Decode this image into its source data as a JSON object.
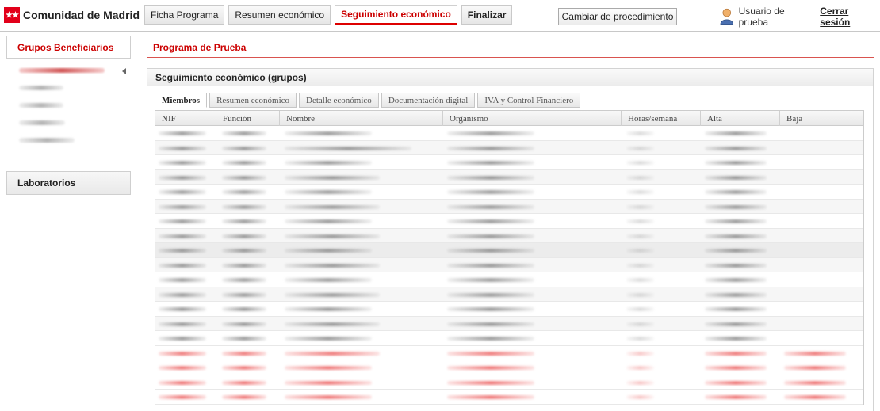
{
  "app": {
    "logo_text": "Comunidad de Madrid",
    "brand_color": "#e2001a"
  },
  "topnav": {
    "tabs": [
      {
        "label": "Ficha Programa"
      },
      {
        "label": "Resumen económico"
      },
      {
        "label": "Seguimiento económico",
        "active": true
      },
      {
        "label": "Finalizar"
      }
    ],
    "cambiar_label": "Cambiar de procedimiento"
  },
  "user": {
    "name": "Usuario de prueba",
    "logout_label": "Cerrar sesión",
    "icon": "user-icon"
  },
  "sidebar": {
    "group1_label": "Grupos Beneficiarios",
    "group2_label": "Laboratorios"
  },
  "main": {
    "program_title": "Programa de Prueba",
    "panel_title": "Seguimiento económico (grupos)",
    "subtabs": [
      {
        "label": "Miembros",
        "active": true
      },
      {
        "label": "Resumen económico"
      },
      {
        "label": "Detalle económico"
      },
      {
        "label": "Documentación digital"
      },
      {
        "label": "IVA y Control Financiero"
      }
    ],
    "columns": [
      "NIF",
      "Función",
      "Nombre",
      "Organismo",
      "Horas/semana",
      "Alta",
      "Baja"
    ]
  },
  "colors": {
    "accent": "#cc0000",
    "highlight_row": "#ececec",
    "error_rows": "#eb5a5a"
  }
}
